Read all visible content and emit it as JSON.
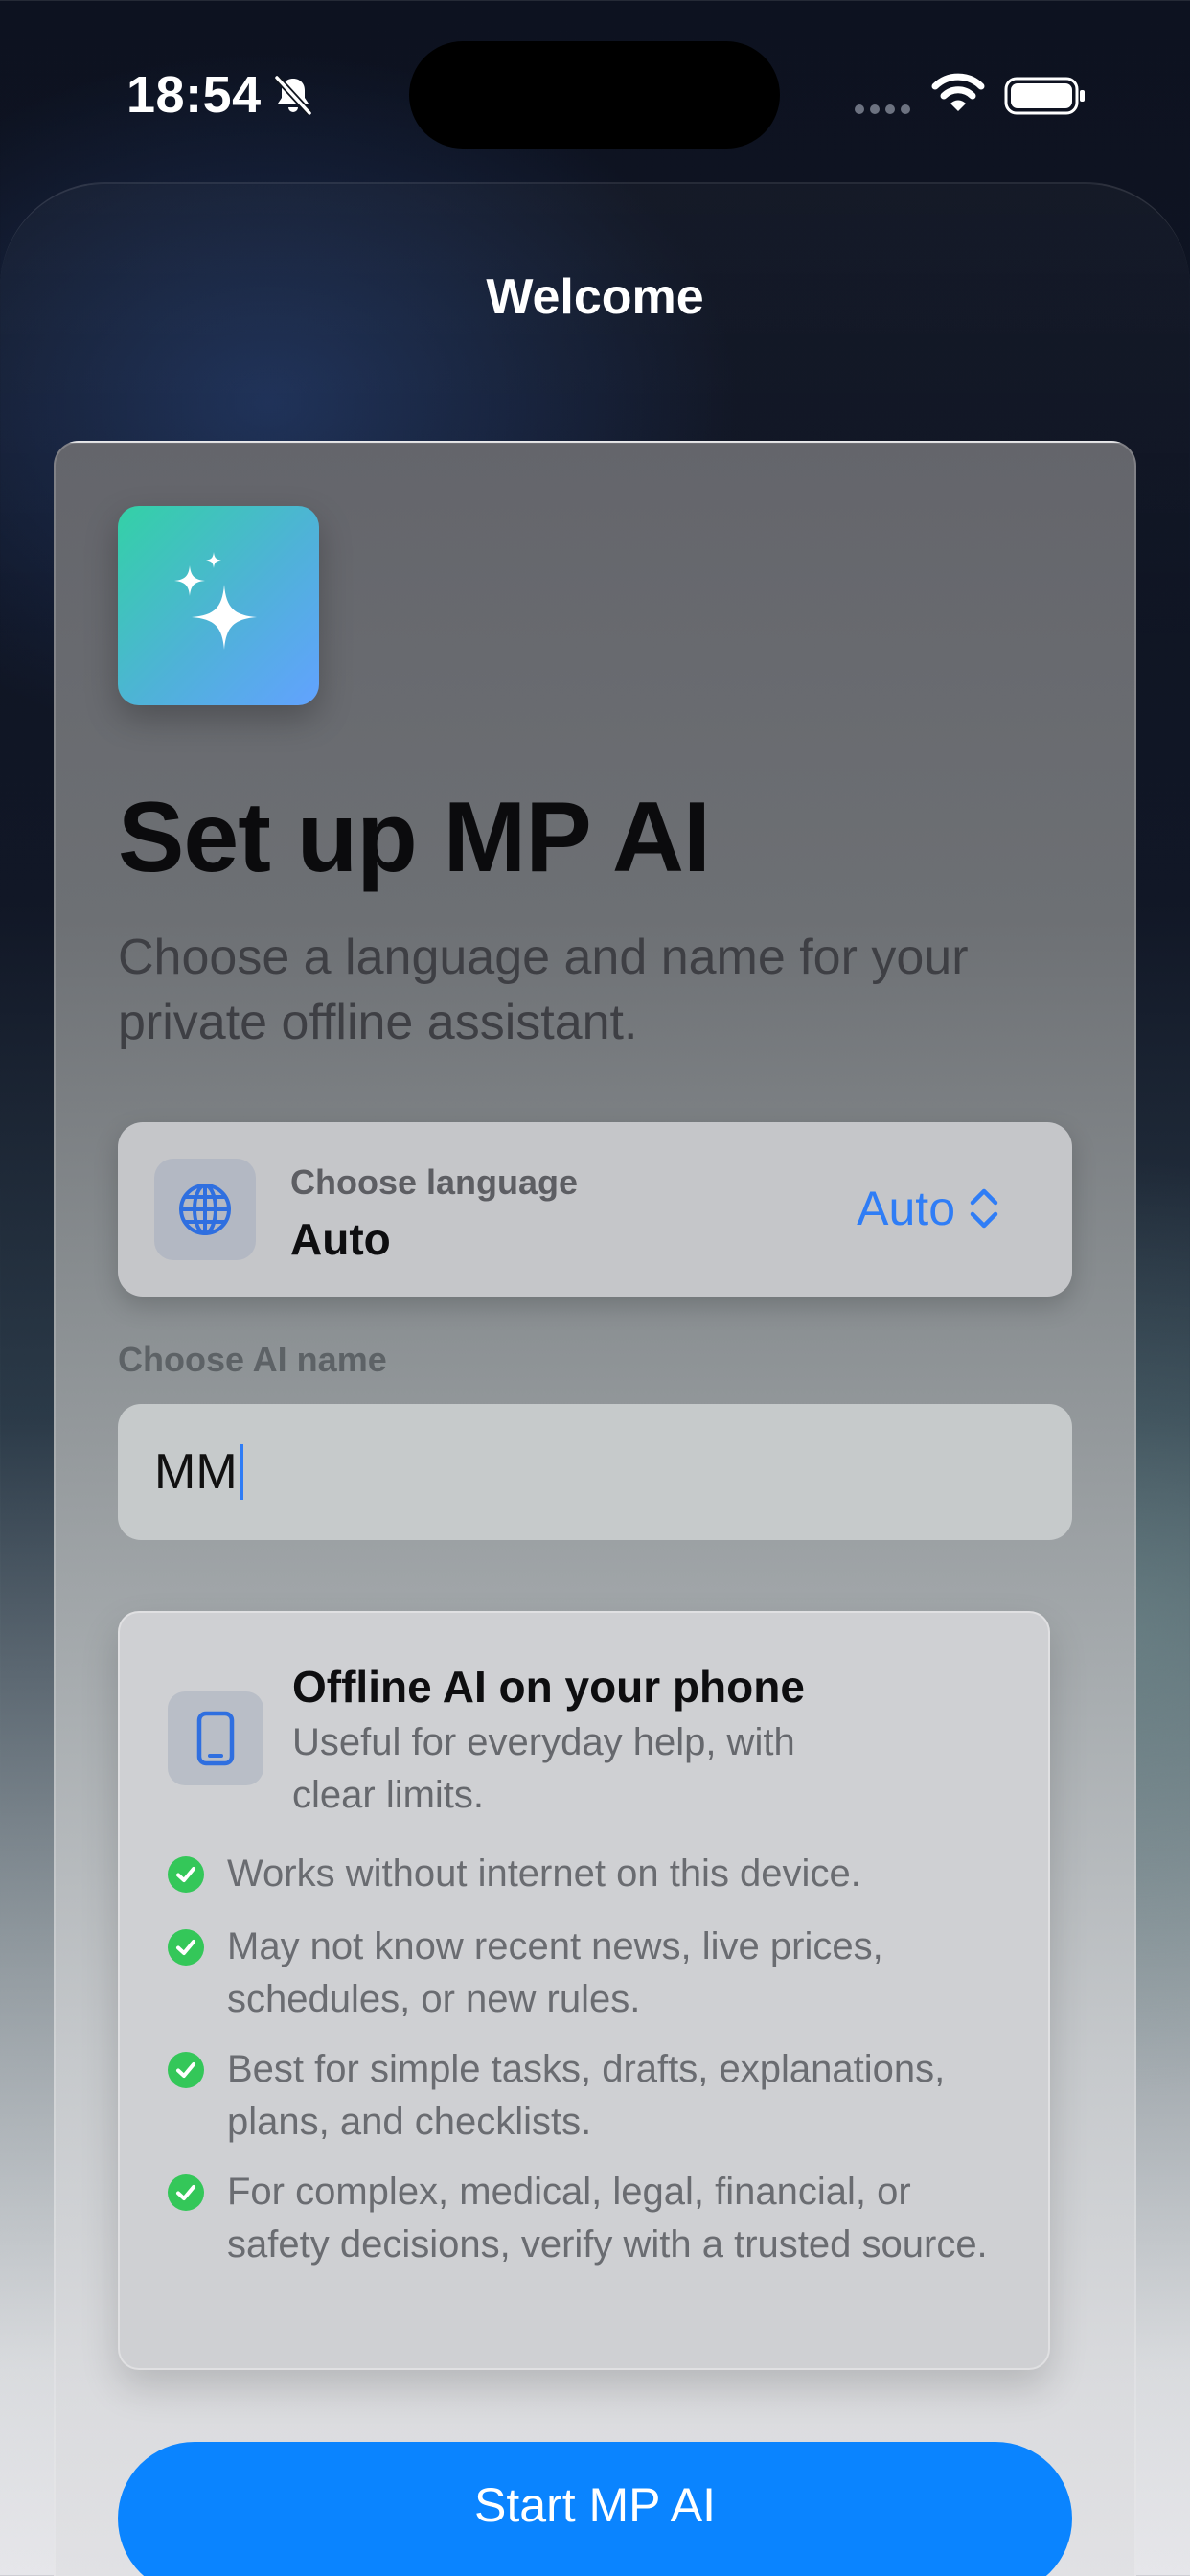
{
  "status_bar": {
    "time": "18:54",
    "icons": [
      "bell-slash-icon",
      "signal-icon",
      "wifi-icon",
      "battery-icon"
    ]
  },
  "sheet": {
    "title": "Welcome"
  },
  "app": {
    "logo_icon": "sparkles-icon"
  },
  "setup": {
    "title": "Set up MP AI",
    "subtitle": "Choose a language and name for your private offline assistant."
  },
  "language": {
    "icon": "globe-icon",
    "label": "Choose language",
    "value": "Auto",
    "picker_value": "Auto"
  },
  "ai_name": {
    "label": "Choose AI name",
    "value": "MM"
  },
  "info": {
    "icon": "phone-icon",
    "title": "Offline AI on your phone",
    "subtitle": "Useful for everyday help, with clear limits.",
    "items": [
      "Works without internet on this device.",
      "May not know recent news, live prices, schedules, or new rules.",
      "Best for simple tasks, drafts, explanations, plans, and checklists.",
      "For complex, medical, legal, financial, or safety decisions, verify with a trusted source."
    ]
  },
  "start_button": {
    "label": "Start MP AI"
  },
  "colors": {
    "accent": "#0a84ff",
    "check_green": "#34c759",
    "logo_gradient_start": "#33d1a6",
    "logo_gradient_end": "#62a2ff"
  }
}
